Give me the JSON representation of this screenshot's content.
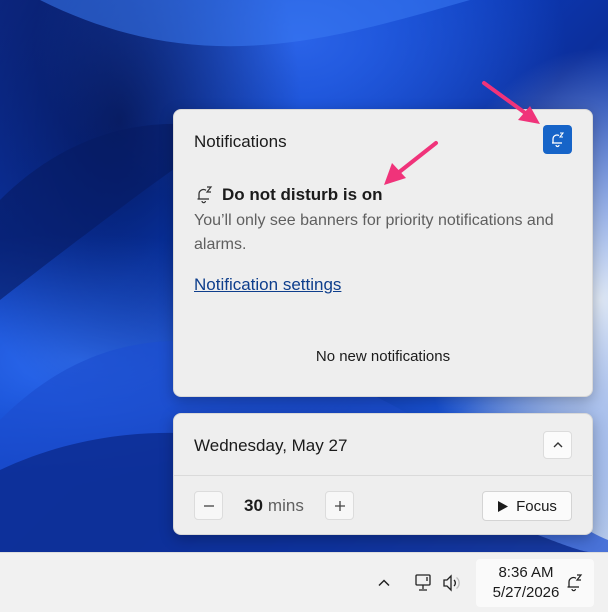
{
  "notifications": {
    "title": "Notifications",
    "dnd_heading": "Do not disturb is on",
    "dnd_description": "You’ll only see banners for priority notifications and alarms.",
    "settings_link": "Notification settings",
    "empty_text": "No new notifications"
  },
  "calendar": {
    "date_label": "Wednesday, May 27",
    "focus_minutes": "30",
    "minutes_unit": "mins",
    "focus_label": "Focus"
  },
  "taskbar": {
    "time": "8:36 AM",
    "date": "5/27/2026"
  },
  "colors": {
    "accent": "#1664c8",
    "annotation_arrow": "#f0337a",
    "link": "#0e3e8c"
  },
  "icons": [
    "dnd-bell-icon",
    "chevron-up-icon",
    "minus-icon",
    "plus-icon",
    "play-icon",
    "network-icon",
    "volume-icon"
  ]
}
